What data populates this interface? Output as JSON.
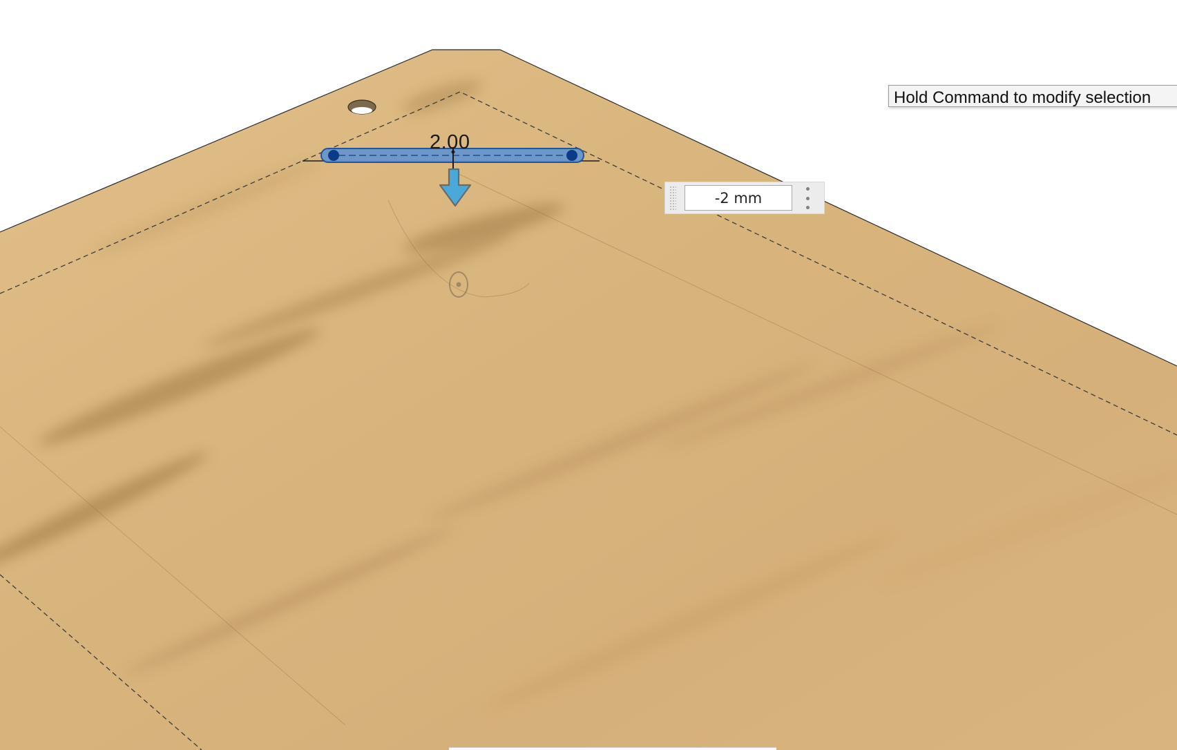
{
  "viewport": {
    "name": "3D model canvas"
  },
  "tooltip": {
    "text": "Hold Command to modify selection"
  },
  "dimension": {
    "label": "2.00",
    "input_value": "-2 mm"
  },
  "icons": {
    "drag_grip": "drag-grip-icon",
    "more": "more-options-icon",
    "direction_arrow": "down-arrow-icon"
  },
  "colors": {
    "wood": "#d9b47e",
    "selection": "#5b8fd6",
    "selection_dark": "#0f3f8c",
    "arrow": "#49a8d8",
    "background": "#ffffff"
  }
}
